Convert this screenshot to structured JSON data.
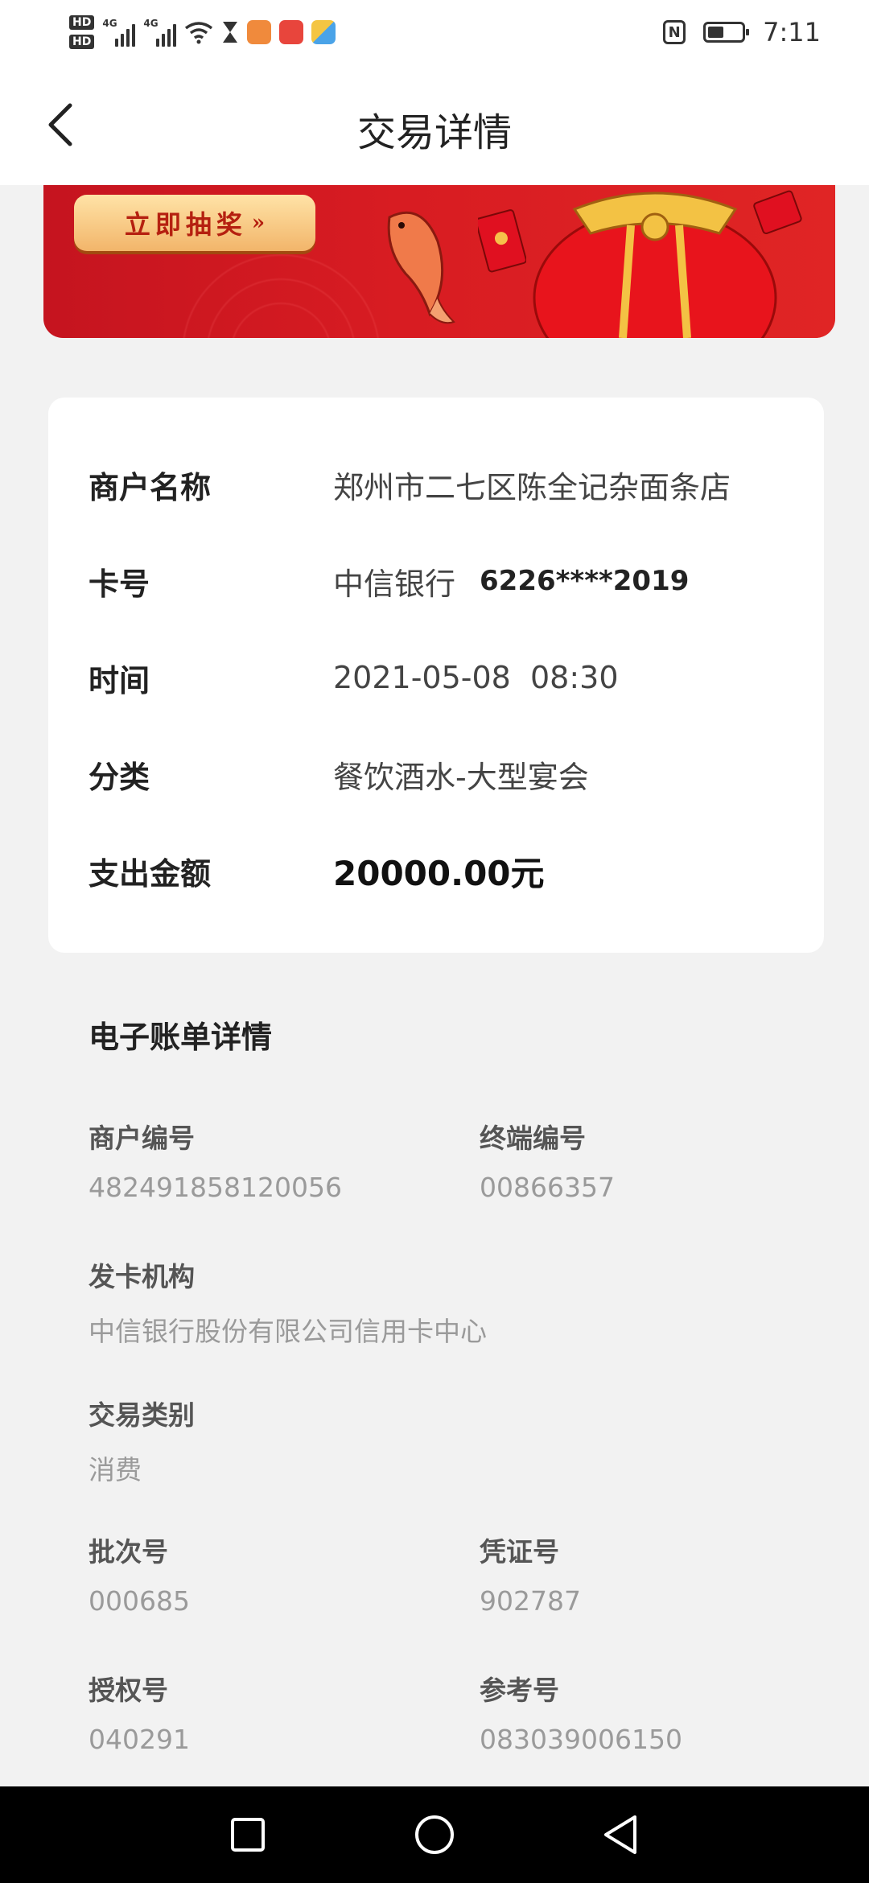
{
  "status_bar": {
    "time": "7:11",
    "hd1": "HD",
    "hd2": "HD",
    "sim1": "4G",
    "sim2": "4G",
    "nfc": "N",
    "icons": [
      "wifi-icon",
      "hourglass-icon",
      "app-heart-icon",
      "app-book-icon",
      "app-grid-icon",
      "nfc-icon",
      "battery-icon"
    ]
  },
  "header": {
    "title": "交易详情"
  },
  "banner": {
    "lottery_label": "立即抽奖",
    "lottery_chevron": "»"
  },
  "details": {
    "merchant_name_label": "商户名称",
    "merchant_name_value": "郑州市二七区陈全记杂面条店",
    "card_label": "卡号",
    "card_bank": "中信银行",
    "card_number": "6226****2019",
    "time_label": "时间",
    "time_value": "2021-05-08  08:30",
    "category_label": "分类",
    "category_value": "餐饮酒水-大型宴会",
    "amount_label": "支出金额",
    "amount_value": "20000.00元"
  },
  "ebill": {
    "title": "电子账单详情",
    "merchant_no_label": "商户编号",
    "merchant_no_value": "482491858120056",
    "terminal_no_label": "终端编号",
    "terminal_no_value": "00866357",
    "issuer_label": "发卡机构",
    "issuer_value": "中信银行股份有限公司信用卡中心",
    "txn_type_label": "交易类别",
    "txn_type_value": "消费",
    "batch_no_label": "批次号",
    "batch_no_value": "000685",
    "voucher_no_label": "凭证号",
    "voucher_no_value": "902787",
    "auth_no_label": "授权号",
    "auth_no_value": "040291",
    "ref_no_label": "参考号",
    "ref_no_value": "083039006150"
  },
  "colors": {
    "banner_red": "#d81c22",
    "button_gold": "#f2b56a",
    "background": "#f2f2f2"
  }
}
